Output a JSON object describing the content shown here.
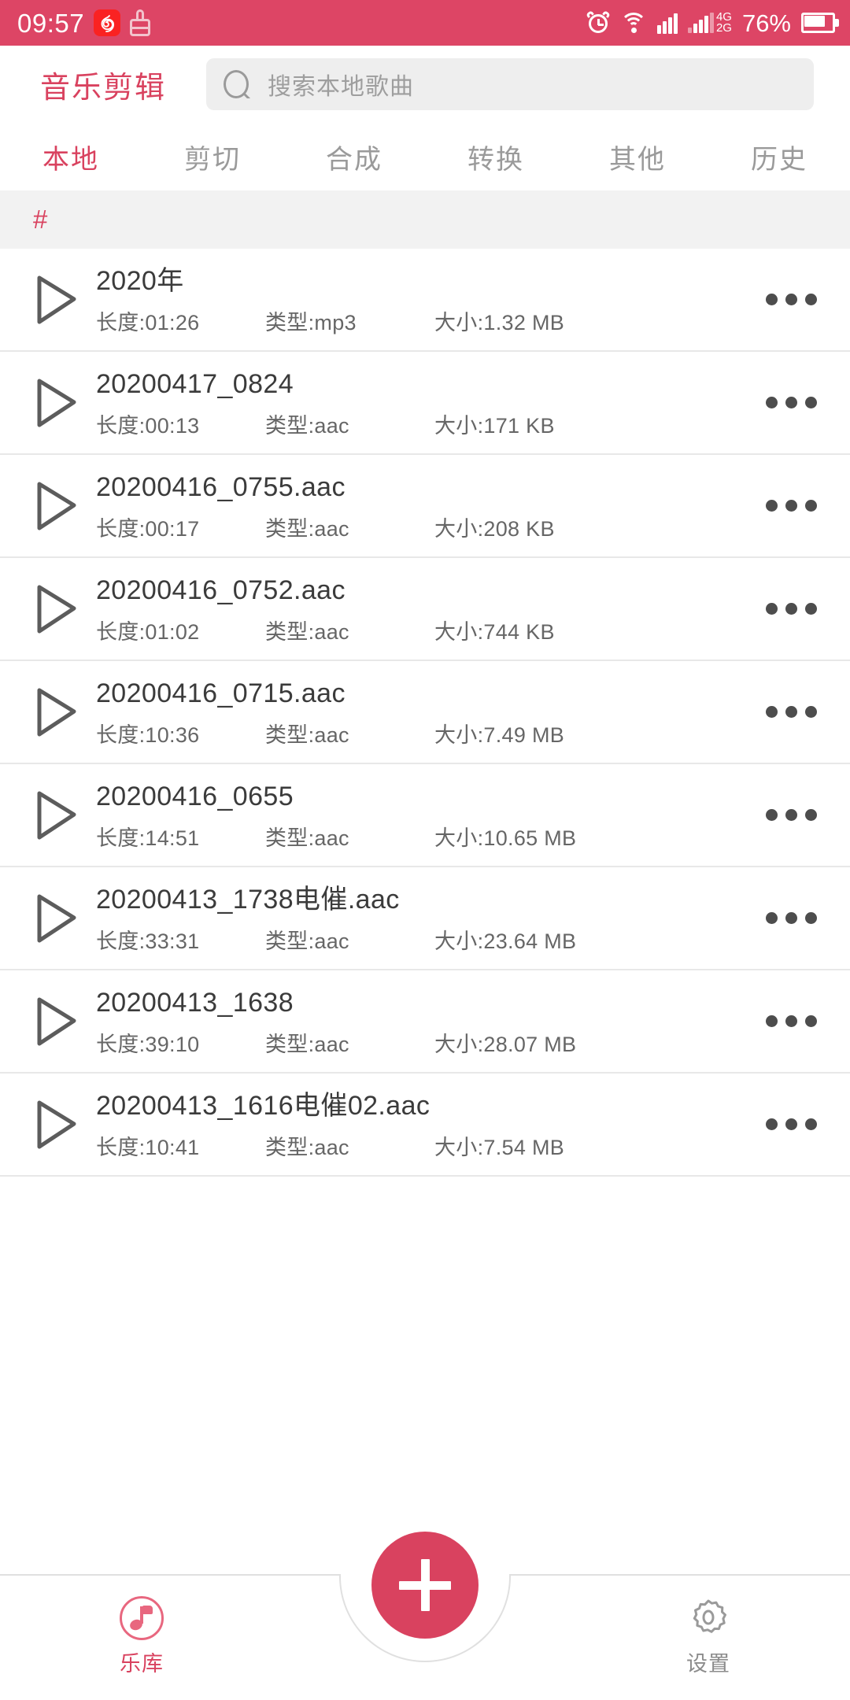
{
  "status_bar": {
    "time": "09:57",
    "netease_glyph": "Ⓐ",
    "battery_percent": "76%",
    "network_primary": "4G",
    "network_secondary": "2G",
    "icons": [
      "netease-music-icon",
      "stamp-icon",
      "alarm-icon",
      "wifi-icon",
      "signal-icon",
      "dual-sim-icon",
      "battery-icon"
    ],
    "background_color": "#DD4565"
  },
  "header": {
    "app_title": "音乐剪辑",
    "search": {
      "placeholder": "搜索本地歌曲",
      "value": "",
      "icon": "search-icon"
    }
  },
  "tabs": {
    "active_index": 0,
    "items": [
      {
        "label": "本地"
      },
      {
        "label": "剪切"
      },
      {
        "label": "合成"
      },
      {
        "label": "转换"
      },
      {
        "label": "其他"
      },
      {
        "label": "历史"
      }
    ]
  },
  "index_band": {
    "label": "#"
  },
  "list": {
    "meta_labels": {
      "duration": "长度:",
      "type": "类型:",
      "size": "大小:"
    },
    "rows": [
      {
        "title": "2020年",
        "duration": "长度:01:26",
        "type": "类型:mp3",
        "size": "大小:1.32 MB"
      },
      {
        "title": "20200417_0824",
        "duration": "长度:00:13",
        "type": "类型:aac",
        "size": "大小:171 KB"
      },
      {
        "title": "20200416_0755.aac",
        "duration": "长度:00:17",
        "type": "类型:aac",
        "size": "大小:208 KB"
      },
      {
        "title": "20200416_0752.aac",
        "duration": "长度:01:02",
        "type": "类型:aac",
        "size": "大小:744 KB"
      },
      {
        "title": "20200416_0715.aac",
        "duration": "长度:10:36",
        "type": "类型:aac",
        "size": "大小:7.49 MB"
      },
      {
        "title": "20200416_0655",
        "duration": "长度:14:51",
        "type": "类型:aac",
        "size": "大小:10.65 MB"
      },
      {
        "title": "20200413_1738电催.aac",
        "duration": "长度:33:31",
        "type": "类型:aac",
        "size": "大小:23.64 MB"
      },
      {
        "title": "20200413_1638",
        "duration": "长度:39:10",
        "type": "类型:aac",
        "size": "大小:28.07 MB"
      },
      {
        "title": "20200413_1616电催02.aac",
        "duration": "长度:10:41",
        "type": "类型:aac",
        "size": "大小:7.54 MB"
      }
    ]
  },
  "bottom_nav": {
    "active_index": 0,
    "items": [
      {
        "label": "乐库",
        "icon": "music-library-icon"
      },
      {
        "label": "设置",
        "icon": "gear-icon"
      }
    ],
    "fab": {
      "icon": "plus-icon",
      "label": "+"
    }
  },
  "colors": {
    "accent": "#D9425F",
    "status_bar": "#DD4565",
    "band": "#F2F2F2",
    "muted_text": "#9a9a9a"
  }
}
